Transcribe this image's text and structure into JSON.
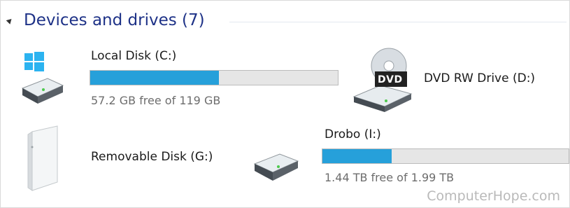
{
  "group": {
    "title": "Devices and drives (7)"
  },
  "drives": [
    {
      "name": "Local Disk (C:)",
      "free_text": "57.2 GB free of 119 GB",
      "used_fraction": 0.52
    },
    {
      "name": "DVD RW Drive (D:)",
      "badge": "DVD"
    },
    {
      "name": "Removable Disk (G:)"
    },
    {
      "name": "Drobo (I:)",
      "free_text": "1.44 TB free of 1.99 TB",
      "used_fraction": 0.28
    }
  ],
  "watermark": "ComputerHope.com",
  "colors": {
    "accent": "#26a0da",
    "title": "#1e3287",
    "windows_logo": "#2cb3f0"
  }
}
